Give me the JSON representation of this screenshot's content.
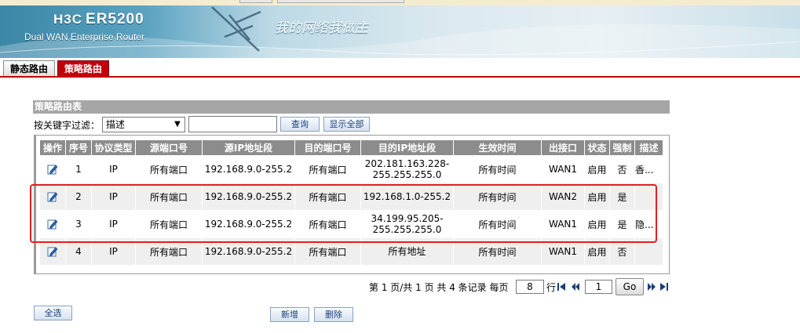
{
  "banner": {
    "brand": "H3C",
    "model": "ER5200",
    "subtitle": "Dual WAN Enterprise Router",
    "slogan": "我的网络我做主"
  },
  "tabs": [
    {
      "label": "静态路由",
      "active": false
    },
    {
      "label": "策略路由",
      "active": true
    }
  ],
  "panel": {
    "title": "策略路由表"
  },
  "filter": {
    "label": "按关键字过滤：",
    "selected": "描述",
    "value": "",
    "search_label": "查询",
    "show_all_label": "显示全部"
  },
  "table": {
    "headers": [
      "操作",
      "序号",
      "协议类型",
      "源端口号",
      "源IP地址段",
      "目的端口号",
      "目的IP地址段",
      "生效时间",
      "出接口",
      "状态",
      "强制",
      "描述"
    ],
    "rows": [
      {
        "seq": "1",
        "proto": "IP",
        "src_port": "所有端口",
        "src_ip": "192.168.9.0-255.2",
        "dst_port": "所有端口",
        "dst_ip": "202.181.163.228-255.255.255.0",
        "time": "所有时间",
        "iface": "WAN1",
        "status": "启用",
        "force": "否",
        "desc": "香..."
      },
      {
        "seq": "2",
        "proto": "IP",
        "src_port": "所有端口",
        "src_ip": "192.168.9.0-255.2",
        "dst_port": "所有端口",
        "dst_ip": "192.168.1.0-255.2",
        "time": "所有时间",
        "iface": "WAN2",
        "status": "启用",
        "force": "是",
        "desc": ""
      },
      {
        "seq": "3",
        "proto": "IP",
        "src_port": "所有端口",
        "src_ip": "192.168.9.0-255.2",
        "dst_port": "所有端口",
        "dst_ip": "34.199.95.205-255.255.255.0",
        "time": "所有时间",
        "iface": "WAN1",
        "status": "启用",
        "force": "是",
        "desc": "隐..."
      },
      {
        "seq": "4",
        "proto": "IP",
        "src_port": "所有端口",
        "src_ip": "192.168.9.0-255.2",
        "dst_port": "所有端口",
        "dst_ip": "所有地址",
        "time": "所有时间",
        "iface": "WAN1",
        "status": "启用",
        "force": "否",
        "desc": ""
      }
    ]
  },
  "pager": {
    "summary": "第 1 页/共 1 页 共 4 条记录 每页",
    "per_page": "8",
    "rows_label": "行",
    "page_input": "1",
    "go_label": "Go"
  },
  "actions": {
    "select_all": "全选",
    "add": "新增",
    "delete": "删除"
  },
  "colors": {
    "accent_red": "#c1000b",
    "header_gray": "#8c8c8c",
    "highlight": "#e02020"
  }
}
